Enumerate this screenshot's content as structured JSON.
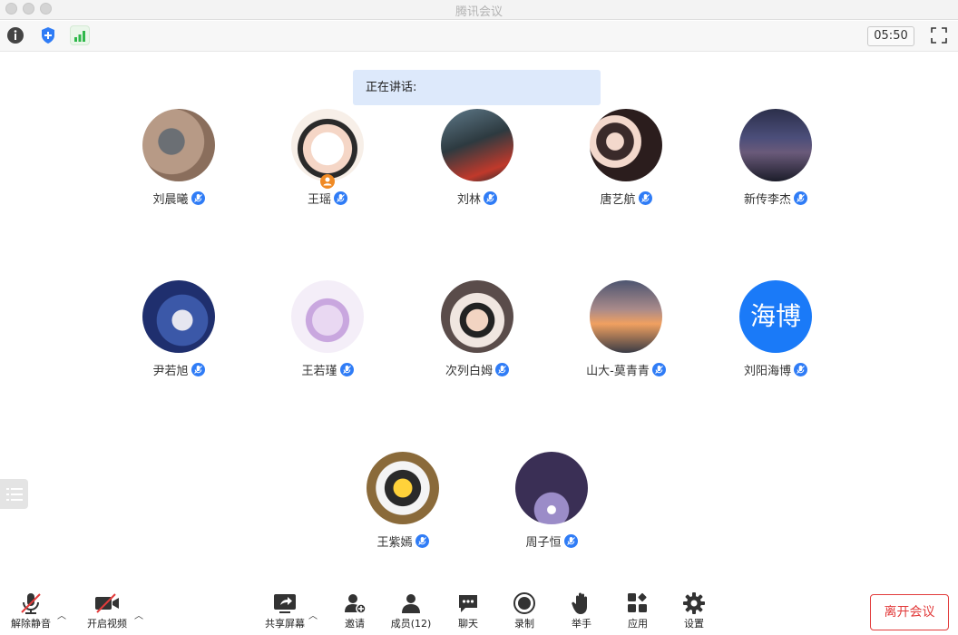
{
  "window": {
    "title": "腾讯会议"
  },
  "topbar": {
    "timer": "05:50"
  },
  "speaking": {
    "label": "正在讲话:"
  },
  "participants": [
    {
      "name": "刘晨曦"
    },
    {
      "name": "王瑶"
    },
    {
      "name": "刘林"
    },
    {
      "name": "唐艺航"
    },
    {
      "name": "新传李杰"
    },
    {
      "name": "尹若旭"
    },
    {
      "name": "王若瑾"
    },
    {
      "name": "次列白姆"
    },
    {
      "name": "山大-莫青青"
    },
    {
      "name": "刘阳海博",
      "avatar_text": "海博"
    },
    {
      "name": "王紫嫣"
    },
    {
      "name": "周子恒"
    }
  ],
  "toolbar": {
    "mute": "解除静音",
    "video": "开启视频",
    "share": "共享屏幕",
    "invite": "邀请",
    "members": "成员(12)",
    "chat": "聊天",
    "record": "录制",
    "raise_hand": "举手",
    "apps": "应用",
    "settings": "设置",
    "leave": "离开会议"
  },
  "colors": {
    "accent": "#2f7cf6",
    "danger": "#e23b3b",
    "speaking_bg": "#dde9fb"
  }
}
